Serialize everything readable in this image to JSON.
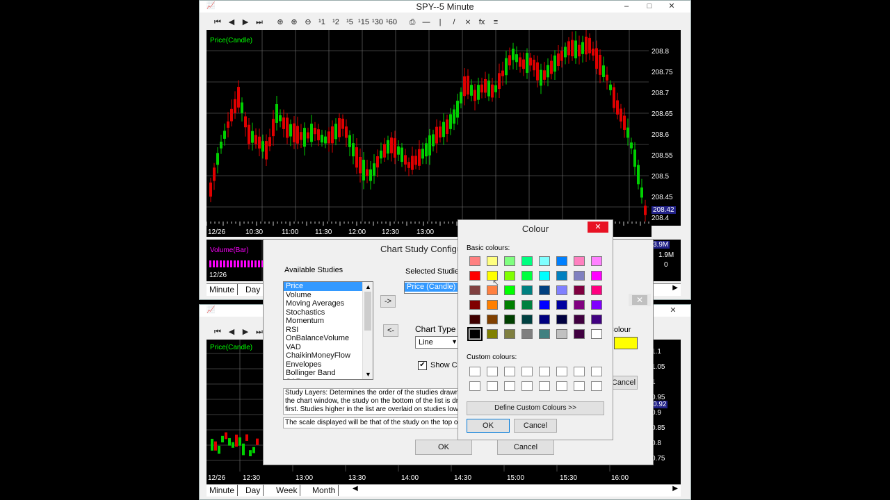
{
  "main_window": {
    "title": "SPY--5 Minute",
    "price_label": "Price(Candle)",
    "volume_label": "Volume(Bar)",
    "price_scale": [
      "208.8",
      "208.75",
      "208.7",
      "208.65",
      "208.6",
      "208.55",
      "208.5",
      "208.45",
      "208.42",
      "208.4"
    ],
    "volume_scale": [
      "3.9M",
      "1.9M",
      "0"
    ],
    "time_axis": [
      "12/26",
      "10:30",
      "11:00",
      "11:30",
      "12:00",
      "12:30",
      "13:00"
    ],
    "vol_date": "12/26",
    "tabs": [
      "Minute",
      "Day"
    ],
    "toolbar_icons": [
      "first-icon",
      "prev-icon",
      "next-icon",
      "last-icon",
      "zoom-in-icon",
      "zoom-add-icon",
      "zoom-out-icon",
      "period-1-icon",
      "period-2-icon",
      "period-5-icon",
      "period-15-icon",
      "period-30-icon",
      "period-60-icon",
      "print-icon",
      "hline-icon",
      "vline-icon",
      "trendline-icon",
      "fib-icon",
      "fx-icon",
      "study-icon"
    ],
    "toolbar_labels": [
      "⏮",
      "◀",
      "▶",
      "⏭",
      "⊕",
      "⊕",
      "⊖",
      "¹1",
      "¹2",
      "¹5",
      "¹15",
      "¹30",
      "¹60",
      "⎙",
      "—",
      "|",
      "/",
      "⨯",
      "fx",
      "≡"
    ]
  },
  "second_window": {
    "price_label": "Price(Candle)",
    "price_scale": [
      "1.1",
      "1.05",
      "1",
      "0.95",
      "0.92",
      "0.9",
      "0.85",
      "0.8",
      "0.75"
    ],
    "time_axis": [
      "12/26",
      "12:30",
      "13:00",
      "13:30",
      "14:00",
      "14:30",
      "15:00",
      "15:30",
      "16:00"
    ],
    "tabs": [
      "Minute",
      "Day",
      "Week",
      "Month"
    ]
  },
  "study_dialog": {
    "title": "Chart Study Configuration",
    "available_label": "Available Studies",
    "selected_label": "Selected Studies",
    "available": [
      "Price",
      "Volume",
      "Moving Averages",
      "Stochastics",
      "Momentum",
      "RSI",
      "OnBalanceVolume",
      "VAD",
      "ChaikinMoneyFlow",
      "Envelopes",
      "Bollinger Band",
      "SAR"
    ],
    "selected": [
      "Price (Candle)"
    ],
    "add_button": "->",
    "remove_button": "<-",
    "chart_type_label": "Chart Type",
    "chart_type_value": "Line",
    "show_checkbox_label": "Show Cursor",
    "colour_label": "Colour",
    "colour_value": "#ffff00",
    "cancel_small": "Cancel",
    "info1": "Study Layers: Determines the order of the studies drawn in the chart window, the study on the bottom of the list is drawn first. Studies higher in the list are overlaid on studies lower on the list.",
    "info2": "The scale displayed will be that of the study on the top of the list.",
    "ok": "OK",
    "cancel": "Cancel"
  },
  "colour_dialog": {
    "title": "Colour",
    "basic_label": "Basic colours:",
    "custom_label": "Custom colours:",
    "define_button": "Define Custom Colours >>",
    "ok": "OK",
    "cancel": "Cancel",
    "basic_colours": [
      "#ff8080",
      "#ffff80",
      "#80ff80",
      "#00ff80",
      "#80ffff",
      "#0080ff",
      "#ff80c0",
      "#ff80ff",
      "#ff0000",
      "#ffff00",
      "#80ff00",
      "#00ff40",
      "#00ffff",
      "#0080c0",
      "#8080c0",
      "#ff00ff",
      "#804040",
      "#ff8040",
      "#00ff00",
      "#008080",
      "#004080",
      "#8080ff",
      "#800040",
      "#ff0080",
      "#800000",
      "#ff8000",
      "#008000",
      "#008040",
      "#0000ff",
      "#0000a0",
      "#800080",
      "#8000ff",
      "#400000",
      "#804000",
      "#004000",
      "#004040",
      "#000080",
      "#000040",
      "#400040",
      "#400080",
      "#000000",
      "#808000",
      "#808040",
      "#808080",
      "#408080",
      "#c0c0c0",
      "#400040",
      "#ffffff"
    ],
    "selected_index": 40
  }
}
